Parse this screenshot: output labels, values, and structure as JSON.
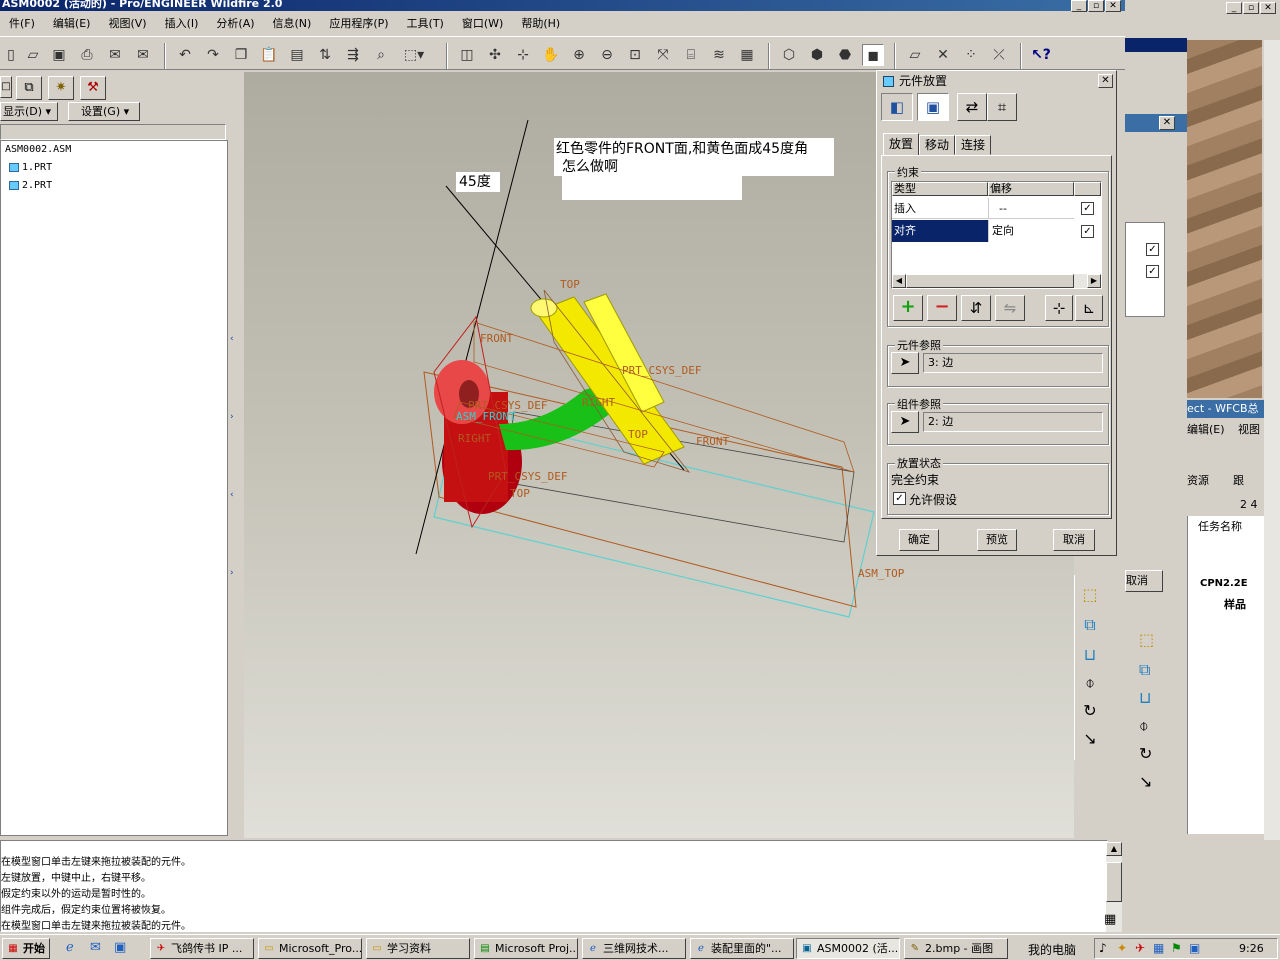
{
  "window": {
    "title": "ASM0002 (活动的) - Pro/ENGINEER Wildfire 2.0"
  },
  "menu": [
    "件(F)",
    "编辑(E)",
    "视图(V)",
    "插入(I)",
    "分析(A)",
    "信息(N)",
    "应用程序(P)",
    "工具(T)",
    "窗口(W)",
    "帮助(H)"
  ],
  "left_panel": {
    "show_label": "显示(D) ▾",
    "settings_label": "设置(G) ▾",
    "tree": [
      "ASM0002.ASM",
      "1.PRT",
      "2.PRT"
    ]
  },
  "viewport": {
    "annotation_question_line1": "红色零件的FRONT面,和黄色面成45度角",
    "annotation_question_line2": "怎么做啊",
    "annotation_angle": "45度",
    "datum_labels": {
      "top1": "TOP",
      "front1": "FRONT",
      "prt_csys1": "PRT_CSYS_DEF",
      "right1": "RIGHT",
      "top2": "TOP",
      "front2": "FRONT",
      "asm_front": "ASM_FRONT",
      "prt_csys2": "PRT_CSYS_DEF",
      "right2": "RIGHT",
      "prt_csys3": "PRT_CSYS_DEF",
      "top3": "TOP",
      "asm_top": "ASM_TOP"
    }
  },
  "dialog": {
    "title": "元件放置",
    "tabs": [
      "放置",
      "移动",
      "连接"
    ],
    "constraints_group": "约束",
    "columns": [
      "类型",
      "偏移"
    ],
    "rows": [
      {
        "type": "插入",
        "offset": "--",
        "checked": "✓"
      },
      {
        "type": "对齐",
        "offset": "定向",
        "checked": "✓"
      }
    ],
    "component_ref_group": "元件参照",
    "component_ref_value": "3: 边",
    "assembly_ref_group": "组件参照",
    "assembly_ref_value": "2: 边",
    "status_group": "放置状态",
    "status_text": "完全约束",
    "allow_assumptions_label": "允许假设",
    "allow_assumptions_checked": "✓",
    "ok": "确定",
    "preview": "预览",
    "cancel": "取消"
  },
  "messages": [
    "在模型窗口单击左键来拖拉被装配的元件。",
    "左键放置，中键中止，右键平移。",
    "假定约束以外的运动是暂时性的。",
    "组件完成后，假定约束位置将被恢复。",
    "在模型窗口单击左键来拖拉被装配的元件。"
  ],
  "right_side": {
    "cancel_label": "取消",
    "ect_title": "ect - WFCB总",
    "menu_frag1": "编辑(E)",
    "menu_frag2": "视图",
    "resource_label": "资源",
    "tracking_label": "跟",
    "num_label": "2  4",
    "task_name_header": "任务名称",
    "task1": "CPN2.2E",
    "task2": "样品"
  },
  "taskbar": {
    "start": "开始",
    "tasks": [
      "飞鸽传书 IP ...",
      "Microsoft_Pro...",
      "学习资料",
      "Microsoft Proj...",
      "三维网技术...",
      "装配里面的\"...",
      "ASM0002 (活...",
      "2.bmp - 画图"
    ],
    "my_computer": "我的电脑",
    "clock": "9:26"
  }
}
